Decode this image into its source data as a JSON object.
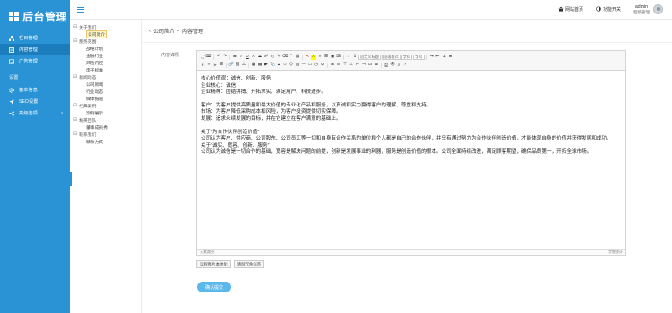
{
  "app": {
    "logo_text": "后台管理"
  },
  "topbar": {
    "site_home": "网站首页",
    "feature_switch": "功能开关",
    "user_name": "admin",
    "user_role": "超级管理"
  },
  "sidebar": {
    "items_top": [
      {
        "label": "栏目管理",
        "icon": "sitemap-icon",
        "active": false
      },
      {
        "label": "内容管理",
        "icon": "document-icon",
        "active": true
      },
      {
        "label": "广告管理",
        "icon": "image-icon",
        "active": false
      }
    ],
    "section": "设置",
    "items_bottom": [
      {
        "label": "基本信息",
        "icon": "gear-icon"
      },
      {
        "label": "SEO设置",
        "icon": "send-icon"
      },
      {
        "label": "高级选项",
        "icon": "share-icon"
      }
    ]
  },
  "tree": [
    {
      "title": "关于我们",
      "leaves": [
        "公司简介"
      ]
    },
    {
      "title": "服务范围",
      "leaves": [
        "战略计划",
        "金融行业",
        "风险内控",
        "电子标准"
      ]
    },
    {
      "title": "新闻动态",
      "leaves": [
        "公司新闻",
        "行业动态",
        "媒体报道"
      ]
    },
    {
      "title": "经典案例",
      "leaves": [
        "案例展示"
      ]
    },
    {
      "title": "精英团队",
      "leaves": [
        "董事成员秀"
      ]
    },
    {
      "title": "联系我们",
      "leaves": [
        "联系方式"
      ]
    }
  ],
  "breadcrumb": {
    "back": "‹",
    "section": "公司简介",
    "sep": "-",
    "page": "内容管理"
  },
  "form": {
    "label": "内容详情"
  },
  "editor": {
    "selects": [
      "段落格式",
      "字体",
      "字号",
      "自定义标题"
    ],
    "paragraphs": [
      {
        "text": "核心价值观：诚信、创新、服务",
        "gap": false
      },
      {
        "text": "企业核心：诚信",
        "gap": false
      },
      {
        "text": "企业精神：团结拼搏、开拓求实、满足用户、科技进步。",
        "gap": false
      },
      {
        "text": "客户：为客户提供高质量和最大价值的专业化产品和服务，以真诚和实力赢得客户的理解、尊重和支持。",
        "gap": true
      },
      {
        "text": "市场：为客户降低采购成本和风险，为客户投资提供切实保障。",
        "gap": false
      },
      {
        "text": "发展：追求永续发展的目标，并在它建立在客户满意的基础上。",
        "gap": false
      },
      {
        "text": "关于“为合作伙伴创造价值”",
        "gap": true
      },
      {
        "text": "公司认为客户、供应商、公司股东、公司员工等一切和自身有合作关系的单位和个人都是自己的合作伙伴，并只有通过努力为合作伙伴创造价值，才能体现自身的价值并获得发展和成功。",
        "gap": false
      },
      {
        "text": "关于“诚实、宽容、创新、服务”",
        "gap": false
      },
      {
        "text": "公司认为诚信是一切合作的基础，宽容是解决问题的前提，创新是发展事业的利器，服务是创造价值的根本。公司全面持续改进，满足顾客期望，确保品质第一，开拓全球市场。",
        "gap": false
      }
    ],
    "status_left": "元素路径:",
    "status_right": "字数统计"
  },
  "aux_buttons": [
    "远程图片本地化",
    "清除冗余标签"
  ],
  "submit": "确认提交"
}
